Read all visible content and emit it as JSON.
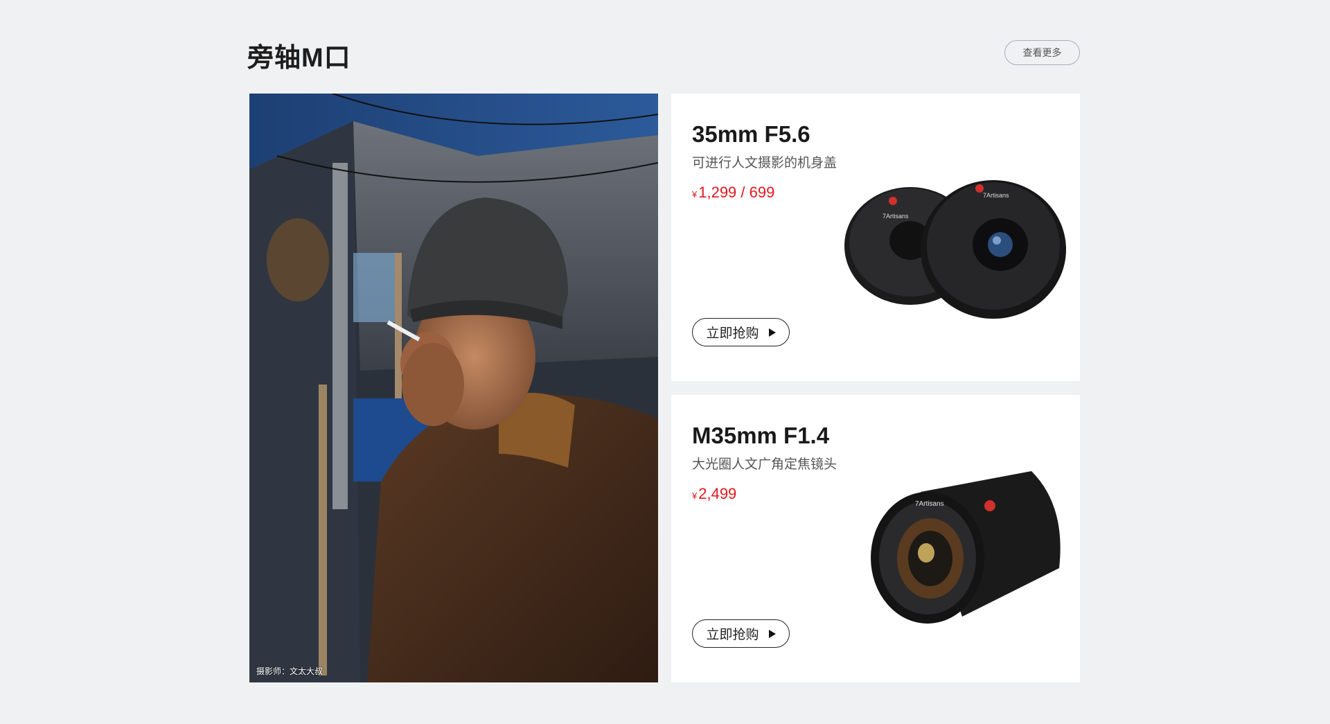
{
  "section": {
    "title": "旁轴M口",
    "more_label": "查看更多"
  },
  "feature_photo": {
    "credit": "摄影师：文太大叔"
  },
  "products": [
    {
      "name": "35mm F5.6",
      "description": "可进行人文摄影的机身盖",
      "currency": "¥",
      "price": "1,299 / 699",
      "buy_label": "立即抢购",
      "lens_brand": "7Artisans"
    },
    {
      "name": "M35mm F1.4",
      "description": "大光圈人文广角定焦镜头",
      "currency": "¥",
      "price": "2,499",
      "buy_label": "立即抢购",
      "lens_brand": "7Artisans"
    }
  ],
  "colors": {
    "background": "#f0f1f3",
    "price": "#e5161d",
    "card": "#ffffff"
  }
}
